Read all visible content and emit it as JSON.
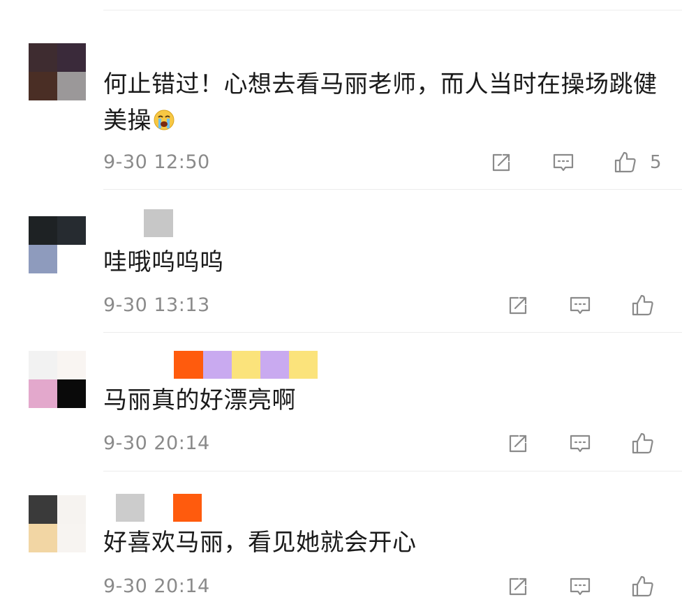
{
  "comments": [
    {
      "text": "何止错过！心想去看马丽老师，而人当时在操场跳健美操",
      "emoji": "crying-emoji",
      "time": "9-30 12:50",
      "likes": "5",
      "avatar_colors": [
        "#3e2c30",
        "#3a2a3a",
        "#4a2e25",
        "#9b9899"
      ],
      "nickname_colors": []
    },
    {
      "text": "哇哦呜呜呜",
      "time": "9-30 13:13",
      "likes": "",
      "avatar_colors": [
        "#1e2224",
        "#262b30",
        "#8e9bbd",
        "#ffffff"
      ],
      "nickname_colors": [
        "#c7c7c7"
      ]
    },
    {
      "text": "马丽真的好漂亮啊",
      "time": "9-30 20:14",
      "likes": "",
      "avatar_colors": [
        "#f2f2f2",
        "#f9f5f2",
        "#e3a8cc",
        "#0a0a0a"
      ],
      "nickname_colors": [
        "#ff5b0d",
        "#c9aaf0",
        "#fbe37b",
        "#c9aaf0",
        "#fbe37b"
      ]
    },
    {
      "text": "好喜欢马丽，看见她就会开心",
      "time": "9-30 20:14",
      "likes": "",
      "avatar_colors": [
        "#3a3a3a",
        "#f6f3f0",
        "#f2d6a4",
        "#f7f4f1"
      ],
      "nickname_colors": [
        "#cccccc",
        "#ff5b0d"
      ]
    }
  ],
  "colors": {
    "text": "#1a1a1a",
    "meta": "#8a8a8a",
    "divider": "#ececec",
    "icon": "#8a8a8a"
  }
}
